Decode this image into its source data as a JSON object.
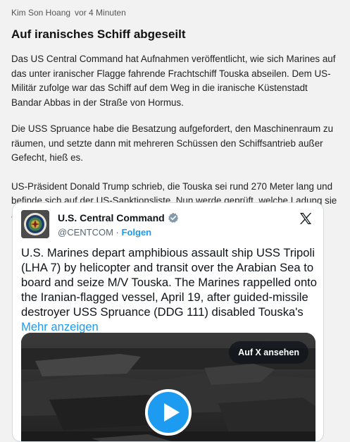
{
  "article": {
    "author": "Kim Son Hoang",
    "time": "vor 4 Minuten",
    "headline": "Auf iranisches Schiff abgeseilt",
    "paragraphs": [
      "Das US Central Command hat Aufnahmen veröffentlicht, wie sich Marines auf das unter iranischer Flagge fahrende Frachtschiff Touska abseilen. Dem US-Militär zufolge war das Schiff auf dem Weg in die iranische Küstenstadt Bandar Abbas in der Straße von Hormus.",
      "Die USS Spruance habe die Besatzung aufgefordert, den Maschinenraum zu räumen, und setzte dann mit mehreren Schüssen den Schiffsantrieb außer Gefecht, hieß es.",
      "US-Präsident Donald Trump schrieb, die Touska sei rund 270 Meter lang und befinde sich auf der US-Sanktionsliste. Nun werde geprüft, welche Ladung sie an Bord hat."
    ]
  },
  "tweet": {
    "display_name": "U.S. Central Command",
    "handle": "@CENTCOM",
    "separator": "·",
    "follow_label": "Folgen",
    "text": "U.S. Marines depart amphibious assault ship USS Tripoli (LHA 7) by helicopter and transit over the Arabian Sea to board and seize M/V Touska. The Marines rappelled onto the Iranian-flagged vessel, April 19, after guided-missile destroyer USS Spruance (DDG 111) disabled Touska's",
    "more_label": "Mehr anzeigen",
    "watch_label": "Auf X ansehen",
    "icons": {
      "avatar": "centcom-seal",
      "verified": "verified-badge-icon",
      "platform": "x-logo-icon",
      "play": "play-icon"
    },
    "colors": {
      "accent": "#1d9bf0",
      "text": "#0f1419",
      "muted": "#536471"
    }
  }
}
